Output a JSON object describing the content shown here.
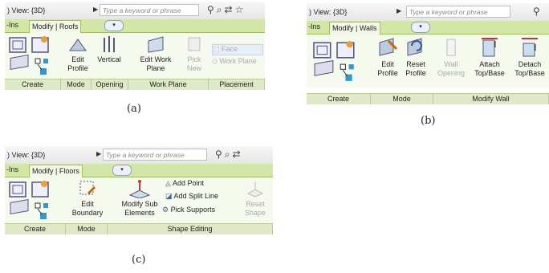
{
  "common": {
    "view_label": ") View: {3D}",
    "search_placeholder": "Type a keyword or phrase",
    "tab_ins": "-Ins"
  },
  "panel_a": {
    "caption": "(a)",
    "tab_active": "Modify | Roofs",
    "buttons": [
      "Edit Profile",
      "Vertical",
      "Edit Work Plane",
      "Pick New",
      "Face",
      "Work Plane"
    ],
    "groups": [
      "Create",
      "Mode",
      "Opening",
      "Work Plane",
      "Placement"
    ]
  },
  "panel_b": {
    "caption": "(b)",
    "tab_active": "Modify | Walls",
    "buttons": [
      "Edit Profile",
      "Reset Profile",
      "Wall Opening",
      "Attach Top/Base",
      "Detach Top/Base"
    ],
    "groups": [
      "Create",
      "Mode",
      "Modify Wall"
    ]
  },
  "panel_c": {
    "caption": "(c)",
    "tab_active": "Modify | Floors",
    "buttons": [
      "Edit Boundary",
      "Modify Sub Elements",
      "Add Point",
      "Add Split Line",
      "Pick Supports",
      "Reset Shape"
    ],
    "groups": [
      "Create",
      "Mode",
      "Shape Editing"
    ]
  }
}
